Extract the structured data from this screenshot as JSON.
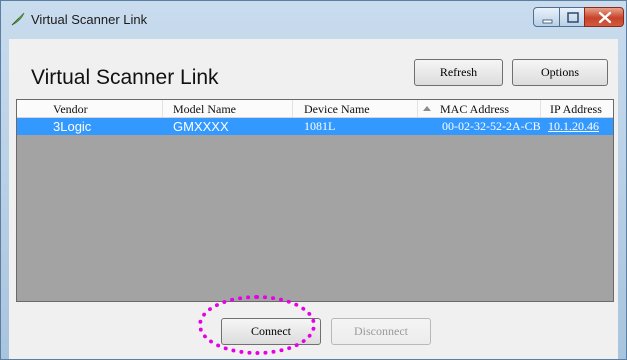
{
  "window": {
    "title": "Virtual Scanner Link",
    "icon": "feather-app-icon",
    "controls": [
      "minimize-icon",
      "maximize-icon",
      "close-icon"
    ]
  },
  "header": {
    "title": "Virtual Scanner Link",
    "refresh_label": "Refresh",
    "options_label": "Options"
  },
  "table": {
    "columns": [
      "Vendor",
      "Model Name",
      "Device Name",
      "MAC Address",
      "IP Address"
    ],
    "sorted_column": "MAC Address",
    "rows": [
      {
        "vendor": "3Logic",
        "model": "GMXXXX",
        "device": "1081L",
        "mac": "00-02-32-52-2A-CB",
        "ip": "10.1.20.46",
        "selected": true
      }
    ]
  },
  "footer": {
    "connect_label": "Connect",
    "disconnect_label": "Disconnect",
    "disconnect_enabled": false
  },
  "colors": {
    "selection": "#3399ff",
    "list_background": "#a3a3a3",
    "highlight_annotation": "#e600e6"
  }
}
